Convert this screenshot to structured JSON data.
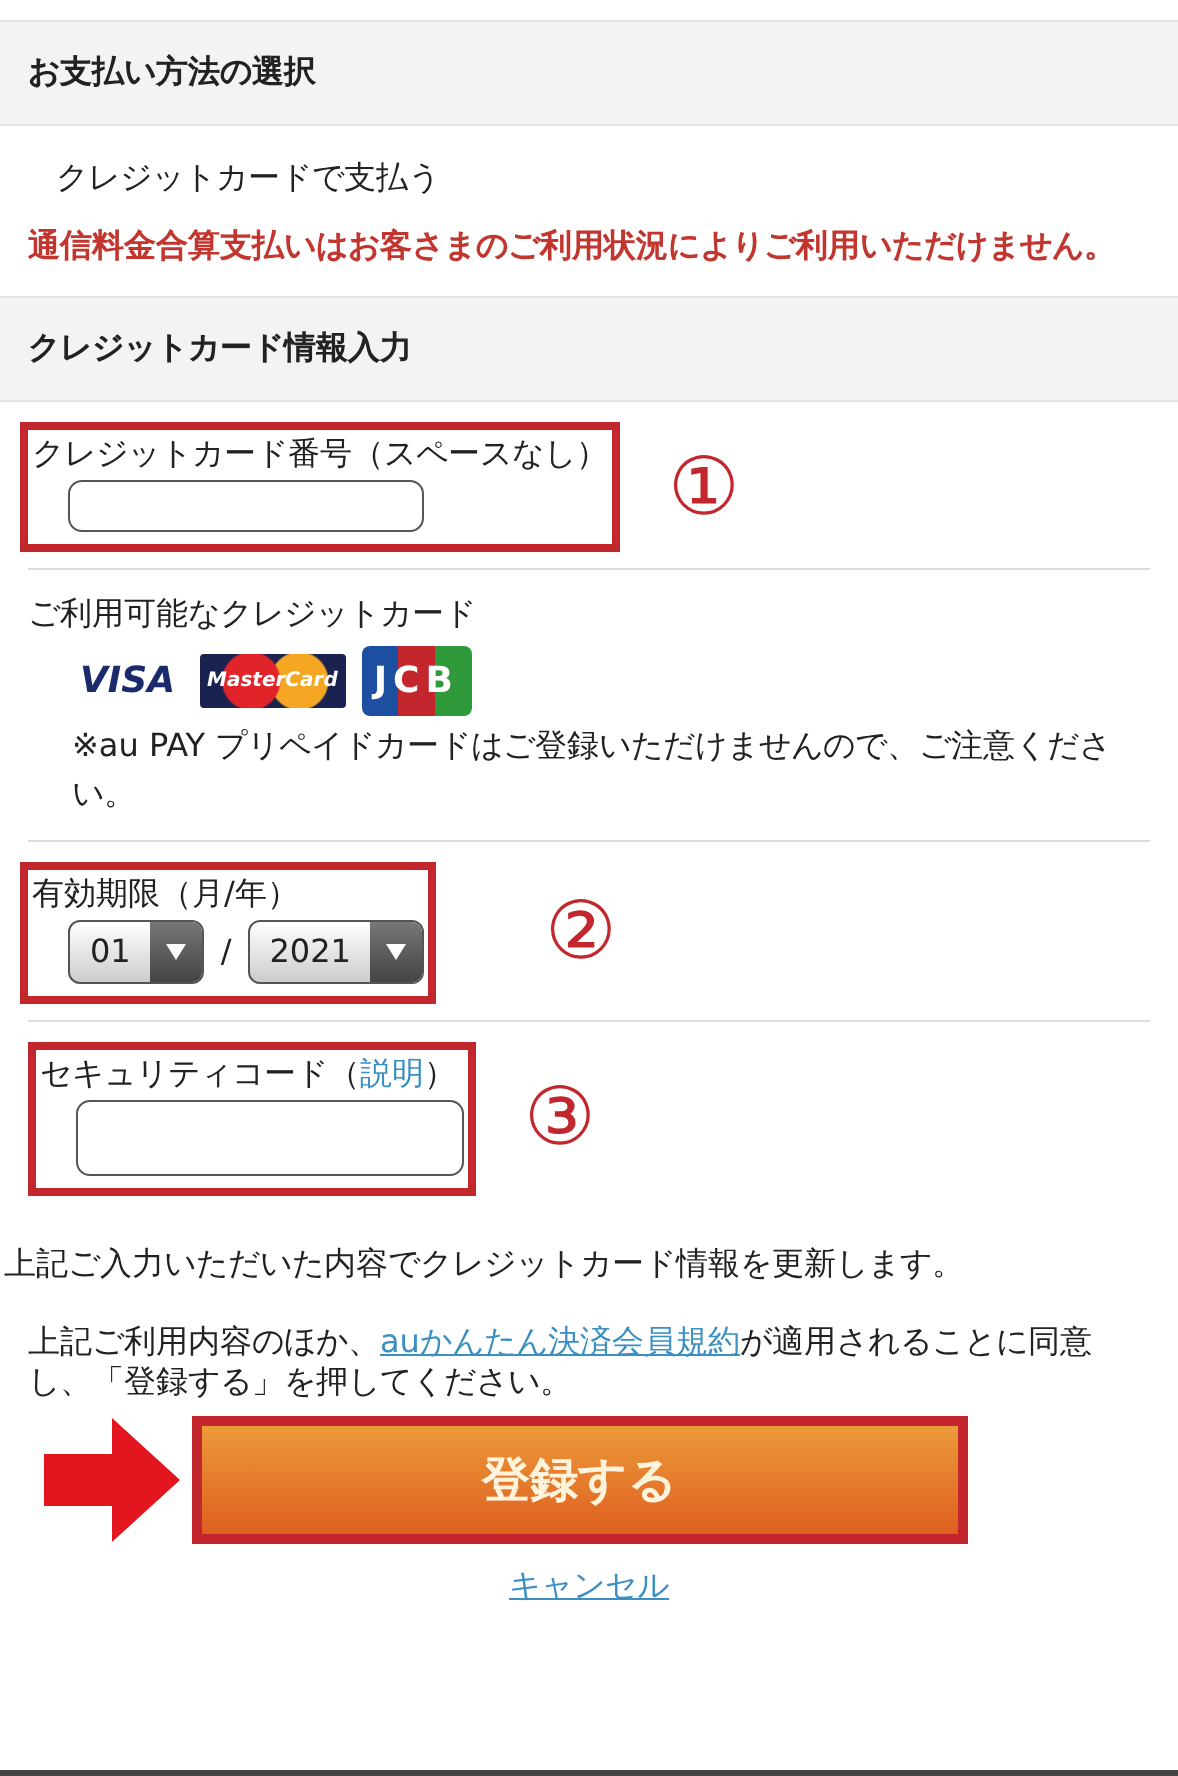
{
  "sections": [
    {
      "heading": "お支払い方法の選択",
      "method": "クレジットカードで支払う",
      "notice": "通信料金合算支払いはお客さまのご利用状況によりご利用いただけません。"
    },
    {
      "heading": "クレジットカード情報入力"
    }
  ],
  "card_number": {
    "label": "クレジットカード番号（スペースなし）",
    "marker": "①"
  },
  "accepted": {
    "label": "ご利用可能なクレジットカード",
    "cards": [
      {
        "kind": "visa",
        "label": "VISA"
      },
      {
        "kind": "mastercard",
        "label": "MasterCard"
      },
      {
        "kind": "jcb",
        "label": "JCB"
      }
    ],
    "note": "※au PAY プリペイドカードはご登録いただけませんので、ご注意ください。"
  },
  "expiry": {
    "label": "有効期限（月/年）",
    "month": "01",
    "separator": "/",
    "year": "2021",
    "marker": "②"
  },
  "security": {
    "label": "セキュリティコード（",
    "link": "説明",
    "label_end": "）",
    "marker": "③"
  },
  "update_text": "上記ご入力いただいた内容でクレジットカード情報を更新します。",
  "terms": {
    "before": "上記ご利用内容のほか、",
    "link": "auかんたん決済会員規約",
    "after": "が適用されることに同意し、「登録する」を押してください。"
  },
  "submit": "登録する",
  "cancel": "キャンセル"
}
